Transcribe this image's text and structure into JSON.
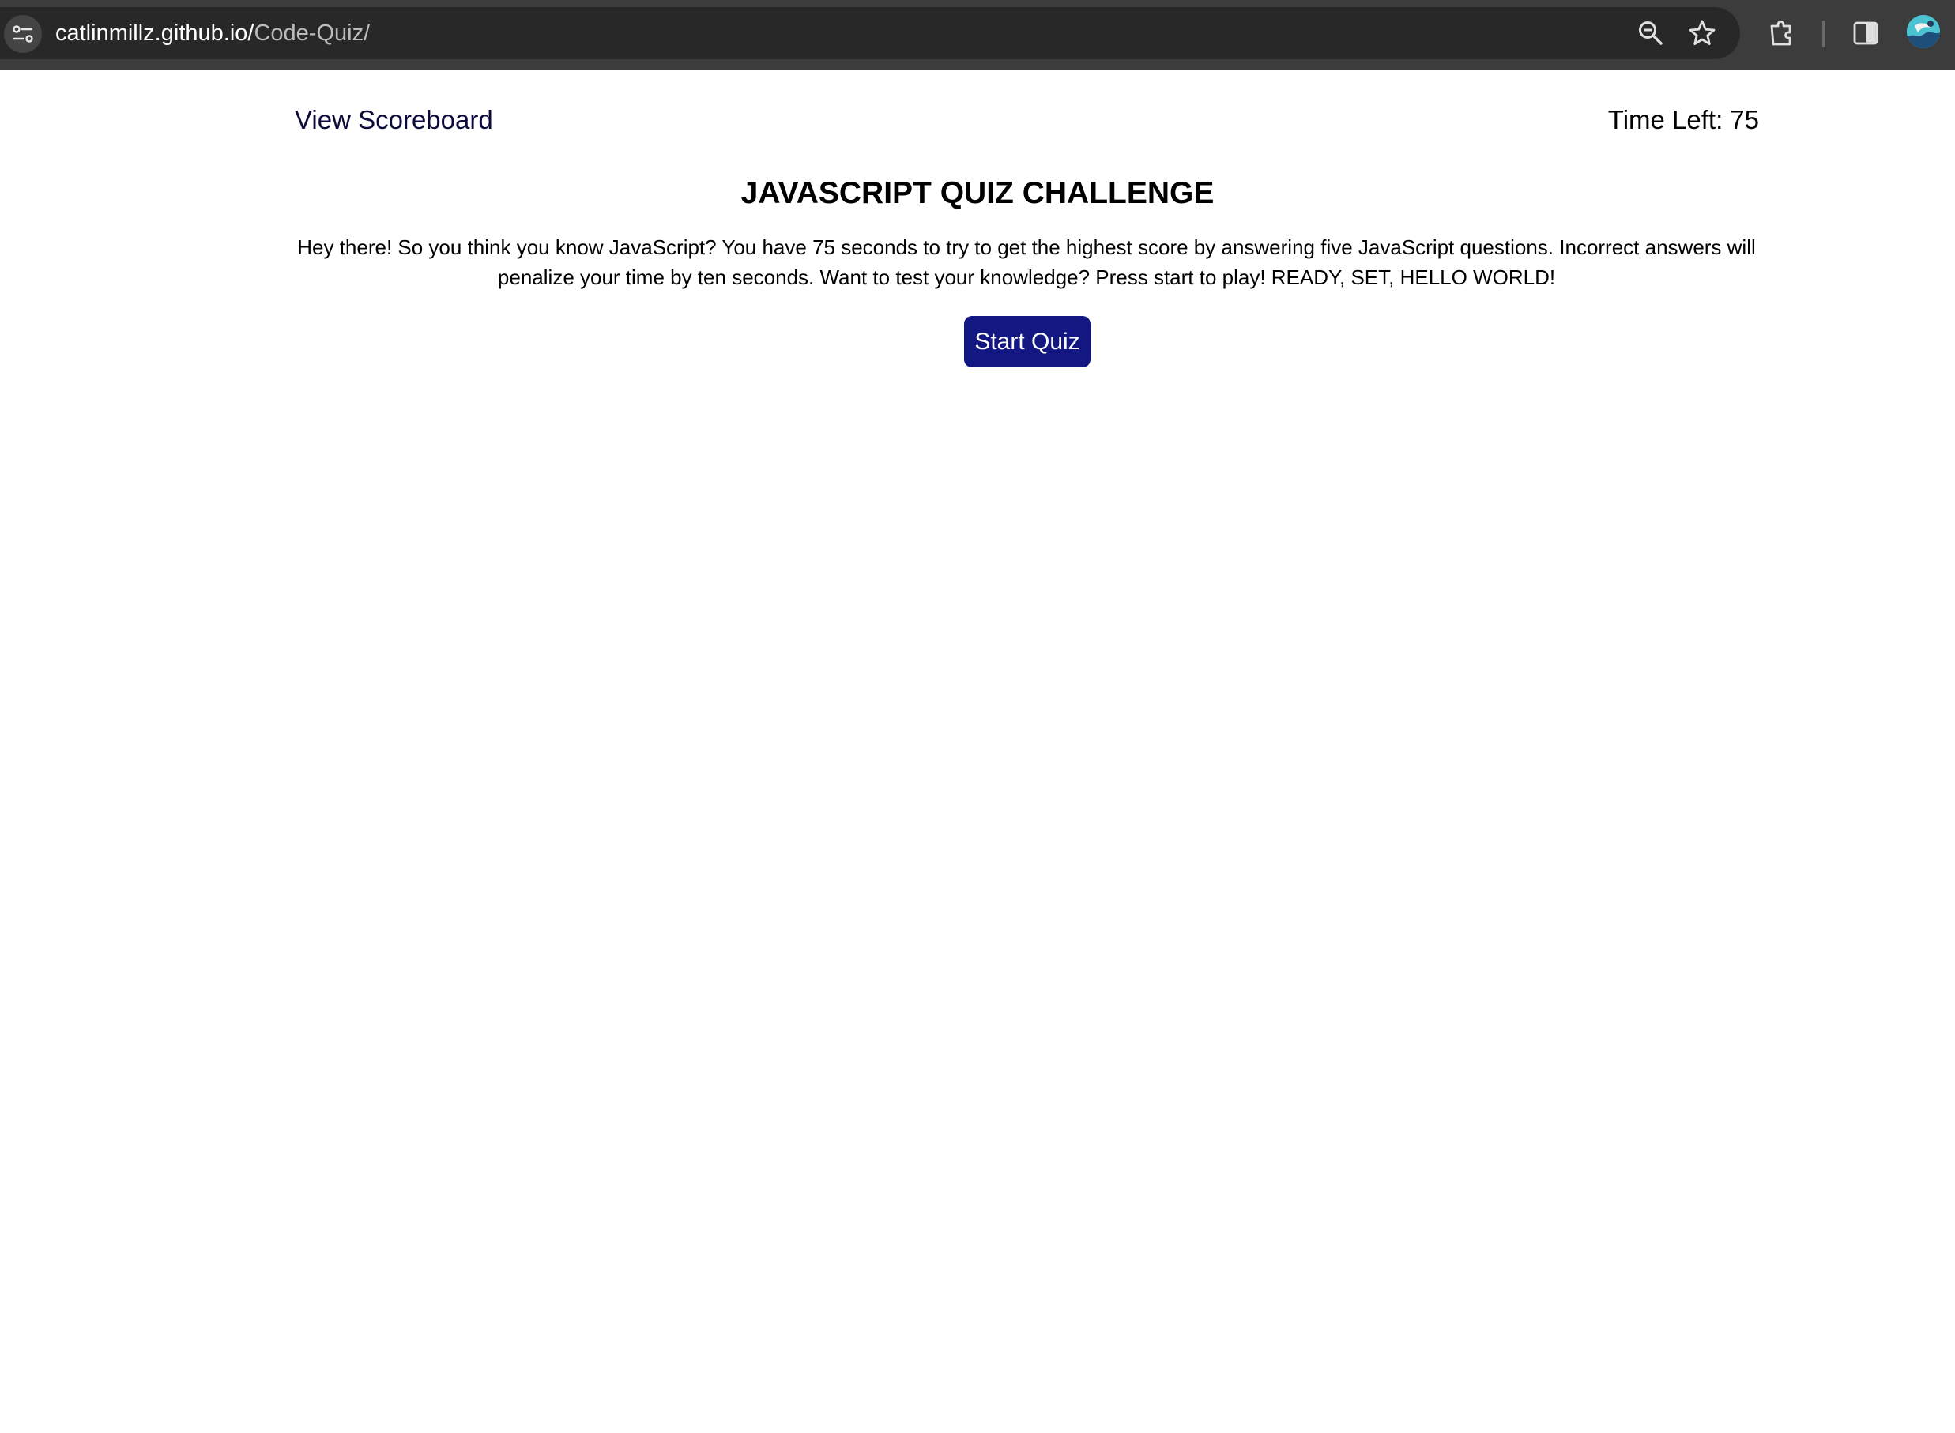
{
  "browser": {
    "url_host": "catlinmillz.github.io/",
    "url_path": "Code-Quiz/",
    "icons": [
      "tune-icon",
      "zoom-out-icon",
      "bookmark-star-icon",
      "extensions-puzzle-icon",
      "side-panel-icon",
      "profile-avatar"
    ]
  },
  "header": {
    "scoreboard_label": "View Scoreboard",
    "timer_label": "Time Left:",
    "timer_value": "75"
  },
  "main": {
    "title": "JAVASCRIPT QUIZ CHALLENGE",
    "intro": "Hey there! So you think you know JavaScript? You have 75 seconds to try to get the highest score by answering five JavaScript questions. Incorrect answers will penalize your time by ten seconds. Want to test your knowledge? Press start to play! READY, SET, HELLO WORLD!",
    "start_label": "Start Quiz"
  },
  "colors": {
    "chrome_bar": "#3c3c3c",
    "omnibox": "#282828",
    "start_button": "#121781",
    "link": "#0a0a3c"
  }
}
